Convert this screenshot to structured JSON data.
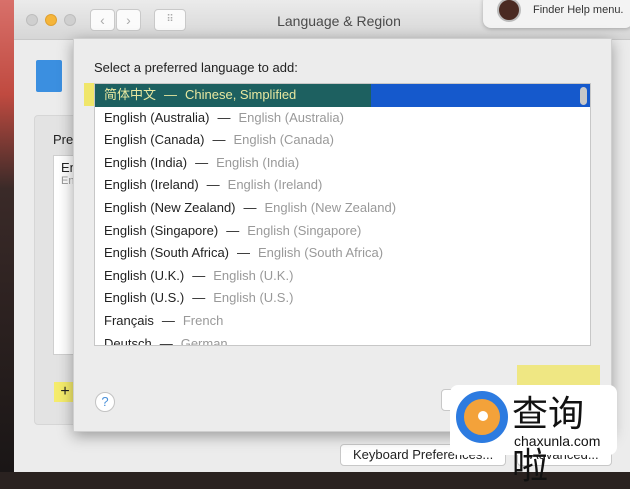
{
  "window": {
    "title": "Language & Region"
  },
  "notification": {
    "text": "Finder Help menu."
  },
  "main": {
    "preferred_label": "Pref",
    "preferred_items": [
      {
        "name": "En",
        "sub": "En"
      }
    ],
    "add_label": "+",
    "keyboard_prefs": "Keyboard Preferences...",
    "advanced": "Advanced..."
  },
  "sheet": {
    "prompt": "Select a preferred language to add:",
    "languages": [
      {
        "native": "简体中文",
        "english": "Chinese, Simplified",
        "selected": true
      },
      {
        "native": "English (Australia)",
        "english": "English (Australia)"
      },
      {
        "native": "English (Canada)",
        "english": "English (Canada)"
      },
      {
        "native": "English (India)",
        "english": "English (India)"
      },
      {
        "native": "English (Ireland)",
        "english": "English (Ireland)"
      },
      {
        "native": "English (New Zealand)",
        "english": "English (New Zealand)"
      },
      {
        "native": "English (Singapore)",
        "english": "English (Singapore)"
      },
      {
        "native": "English (South Africa)",
        "english": "English (South Africa)"
      },
      {
        "native": "English (U.K.)",
        "english": "English (U.K.)"
      },
      {
        "native": "English (U.S.)",
        "english": "English (U.S.)"
      },
      {
        "native": "Français",
        "english": "French"
      },
      {
        "native": "Deutsch",
        "english": "German"
      }
    ],
    "separator": "—",
    "help": "?"
  },
  "watermark": {
    "text": "查询啦",
    "url": "chaxunla.com"
  },
  "colors": {
    "selection": "#1559cc",
    "highlight": "#f0e66a"
  }
}
